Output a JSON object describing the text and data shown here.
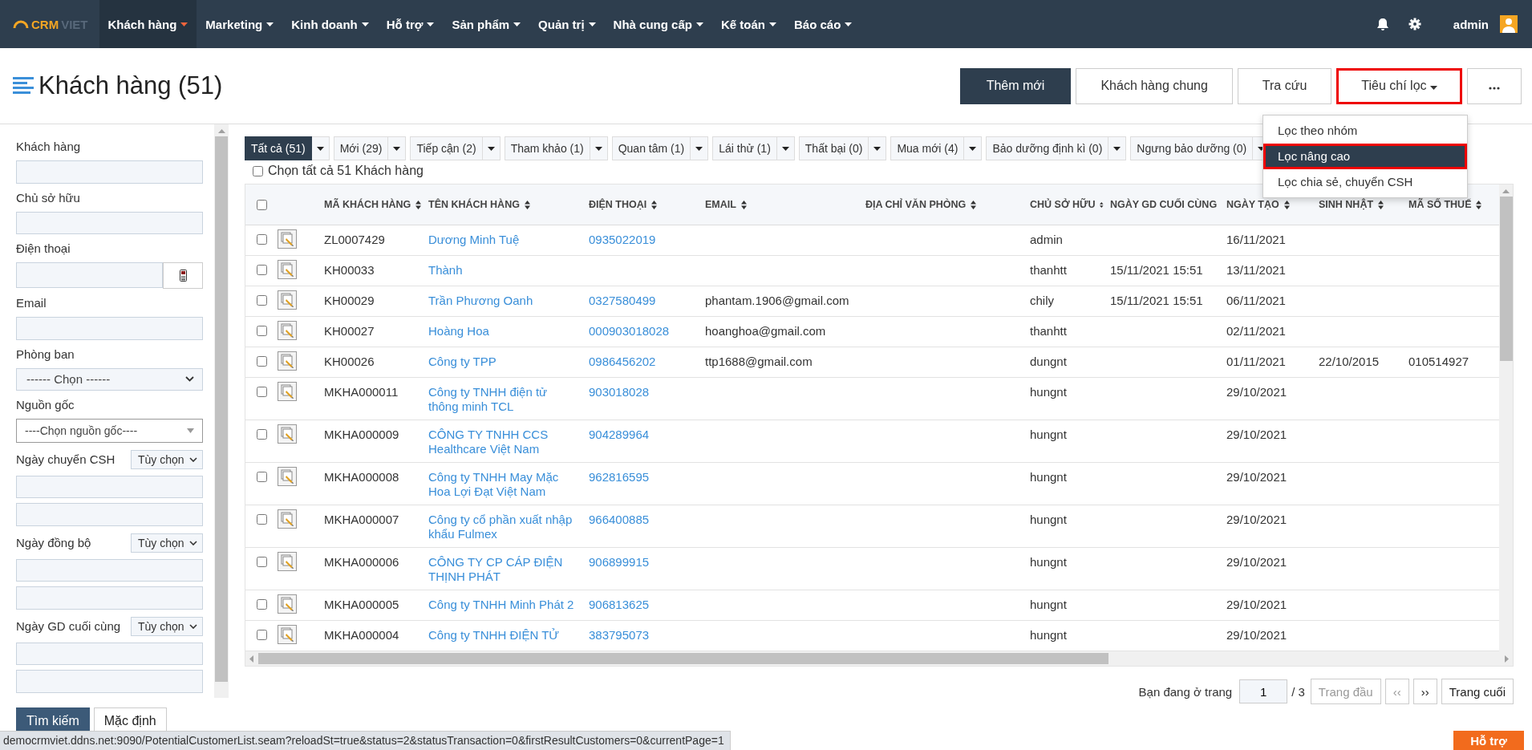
{
  "nav": {
    "logo": {
      "primary": "CRM",
      "secondary": "VIET"
    },
    "items": [
      {
        "label": "Khách hàng",
        "selected": true
      },
      {
        "label": "Marketing",
        "selected": false
      },
      {
        "label": "Kinh doanh",
        "selected": false
      },
      {
        "label": "Hỗ trợ",
        "selected": false
      },
      {
        "label": "Sản phẩm",
        "selected": false
      },
      {
        "label": "Quản trị",
        "selected": false
      },
      {
        "label": "Nhà cung cấp",
        "selected": false
      },
      {
        "label": "Kế toán",
        "selected": false
      },
      {
        "label": "Báo cáo",
        "selected": false
      }
    ],
    "user": "admin"
  },
  "header": {
    "title": "Khách hàng (51)",
    "buttons": [
      {
        "kind": "primary",
        "label": "Thêm mới"
      },
      {
        "kind": "default",
        "label": "Khách hàng chung"
      },
      {
        "kind": "default",
        "label": "Tra cứu"
      },
      {
        "kind": "filter",
        "label": "Tiêu chí lọc"
      },
      {
        "kind": "more"
      }
    ]
  },
  "filter_menu": [
    {
      "label": "Lọc theo nhóm",
      "selected": false
    },
    {
      "label": "Lọc nâng cao",
      "selected": true
    },
    {
      "label": "Lọc chia sẻ, chuyển CSH",
      "selected": false
    }
  ],
  "sidebar": {
    "fields": [
      {
        "kind": "text",
        "label": "Khách hàng"
      },
      {
        "kind": "text",
        "label": "Chủ sở hữu"
      },
      {
        "kind": "phone",
        "label": "Điện thoại"
      },
      {
        "kind": "text",
        "label": "Email"
      },
      {
        "kind": "select",
        "label": "Phòng ban",
        "value": "------ Chọn ------"
      },
      {
        "kind": "combo",
        "label": "Nguồn gốc",
        "value": "----Chọn nguồn gốc----"
      },
      {
        "kind": "date_range",
        "label": "Ngày chuyển CSH",
        "option": "Tùy chọn"
      },
      {
        "kind": "date_range",
        "label": "Ngày đồng bộ",
        "option": "Tùy chọn"
      },
      {
        "kind": "date_range",
        "label": "Ngày GD cuối cùng",
        "option": "Tùy chọn"
      }
    ],
    "buttons": [
      {
        "kind": "primary",
        "label": "Tìm kiếm"
      },
      {
        "kind": "default",
        "label": "Mặc định"
      }
    ]
  },
  "status_tabs": [
    {
      "label": "Tất cả (51)",
      "selected": true
    },
    {
      "label": "Mới (29)",
      "selected": false
    },
    {
      "label": "Tiếp cận (2)",
      "selected": false
    },
    {
      "label": "Tham khảo (1)",
      "selected": false
    },
    {
      "label": "Quan tâm (1)",
      "selected": false
    },
    {
      "label": "Lái thử (1)",
      "selected": false
    },
    {
      "label": "Thất bại (0)",
      "selected": false
    },
    {
      "label": "Mua mới (4)",
      "selected": false
    },
    {
      "label": "Bảo dưỡng định kì (0)",
      "selected": false
    },
    {
      "label": "Ngưng bảo dưỡng (0)",
      "selected": false
    }
  ],
  "select_all": {
    "label": "Chọn tất cả 51 Khách hàng",
    "checked": false
  },
  "table": {
    "header_checked": false,
    "columns": [
      "MÃ KHÁCH HÀNG",
      "TÊN KHÁCH HÀNG",
      "ĐIỆN THOẠI",
      "EMAIL",
      "ĐỊA CHỈ VĂN PHÒNG",
      "CHỦ SỞ HỮU",
      "NGÀY GD CUỐI CÙNG",
      "NGÀY TẠO",
      "SINH NHẬT",
      "MÃ SỐ THUẾ"
    ],
    "rows": [
      {
        "checked": false,
        "cells": [
          "ZL0007429",
          "Dương Minh Tuệ",
          "0935022019",
          "",
          "",
          "admin",
          "",
          "16/11/2021",
          "",
          ""
        ]
      },
      {
        "checked": false,
        "cells": [
          "KH00033",
          "Thành",
          "",
          "",
          "",
          "thanhtt",
          "15/11/2021 15:51",
          "13/11/2021",
          "",
          ""
        ]
      },
      {
        "checked": false,
        "cells": [
          "KH00029",
          "Trần Phương Oanh",
          "0327580499",
          "phantam.1906@gmail.com",
          "",
          "chily",
          "15/11/2021 15:51",
          "06/11/2021",
          "",
          ""
        ]
      },
      {
        "checked": false,
        "cells": [
          "KH00027",
          "Hoàng Hoa",
          "000903018028",
          "hoanghoa@gmail.com",
          "",
          "thanhtt",
          "",
          "02/11/2021",
          "",
          ""
        ]
      },
      {
        "checked": false,
        "cells": [
          "KH00026",
          "Công ty TPP",
          "0986456202",
          "ttp1688@gmail.com",
          "",
          "dungnt",
          "",
          "01/11/2021",
          "22/10/2015",
          "010514927"
        ]
      },
      {
        "checked": false,
        "cells": [
          "MKHA000011",
          "Công ty TNHH điện tử thông minh TCL",
          "903018028",
          "",
          "",
          "hungnt",
          "",
          "29/10/2021",
          "",
          ""
        ]
      },
      {
        "checked": false,
        "cells": [
          "MKHA000009",
          "CÔNG TY TNHH CCS Healthcare Việt Nam",
          "904289964",
          "",
          "",
          "hungnt",
          "",
          "29/10/2021",
          "",
          ""
        ]
      },
      {
        "checked": false,
        "cells": [
          "MKHA000008",
          "Công ty TNHH May Mặc Hoa Lợi Đạt Việt Nam",
          "962816595",
          "",
          "",
          "hungnt",
          "",
          "29/10/2021",
          "",
          ""
        ]
      },
      {
        "checked": false,
        "cells": [
          "MKHA000007",
          "Công ty cổ phần xuất nhập khẩu Fulmex",
          "966400885",
          "",
          "",
          "hungnt",
          "",
          "29/10/2021",
          "",
          ""
        ]
      },
      {
        "checked": false,
        "cells": [
          "MKHA000006",
          "CÔNG TY CP CÁP ĐIỆN THỊNH PHÁT",
          "906899915",
          "",
          "",
          "hungnt",
          "",
          "29/10/2021",
          "",
          ""
        ]
      },
      {
        "checked": false,
        "cells": [
          "MKHA000005",
          "Công ty TNHH Minh Phát 2",
          "906813625",
          "",
          "",
          "hungnt",
          "",
          "29/10/2021",
          "",
          ""
        ]
      },
      {
        "checked": false,
        "cells": [
          "MKHA000004",
          "Công ty TNHH ĐIỆN TỬ",
          "383795073",
          "",
          "",
          "hungnt",
          "",
          "29/10/2021",
          "",
          ""
        ]
      }
    ]
  },
  "pagination": {
    "label": "Bạn đang ở trang",
    "page": "1",
    "total": "/ 3",
    "buttons": [
      {
        "label": "Trang đầu",
        "disabled": true
      },
      {
        "label": "‹‹",
        "disabled": true
      },
      {
        "label": "››",
        "disabled": false
      },
      {
        "label": "Trang cuối",
        "disabled": false
      }
    ]
  },
  "status_url": "democrmviet.ddns.net:9090/PotentialCustomerList.seam?reloadSt=true&status=2&statusTransaction=0&firstResultCustomers=0&currentPage=1",
  "help_button": "Hỗ trợ"
}
